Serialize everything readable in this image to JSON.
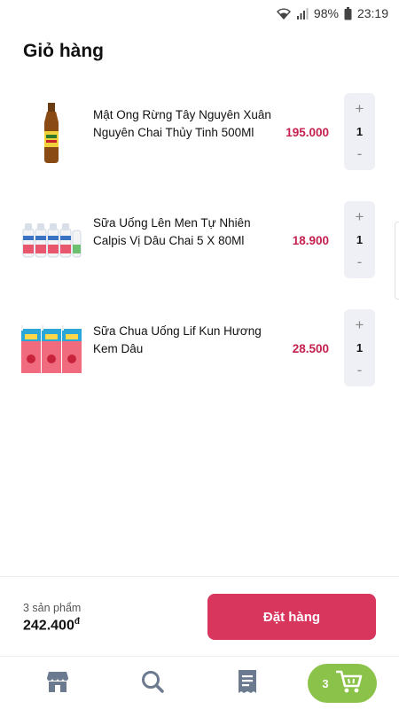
{
  "status_bar": {
    "battery": "98%",
    "time": "23:19",
    "icons": [
      "wifi-icon",
      "signal-icon",
      "battery-icon"
    ]
  },
  "page": {
    "title": "Giỏ hàng"
  },
  "cart": {
    "items": [
      {
        "name": "Mật Ong Rừng Tây Nguyên Xuân Nguyên Chai Thủy Tinh 500Ml",
        "price": "195.000",
        "qty": "1",
        "thumb": "honey-bottle-image"
      },
      {
        "name": "Sữa Uống Lên Men Tự Nhiên Calpis Vị Dâu Chai 5 X 80Ml",
        "price": "18.900",
        "qty": "1",
        "thumb": "calpis-bottles-image"
      },
      {
        "name": "Sữa Chua Uống Lif Kun Hương Kem Dâu",
        "price": "28.500",
        "qty": "1",
        "thumb": "lif-kun-boxes-image"
      }
    ],
    "plus_symbol": "+",
    "minus_symbol": "-"
  },
  "footer": {
    "product_count": "3 sản phẩm",
    "total": "242.400",
    "currency": "đ",
    "order_label": "Đặt hàng"
  },
  "bottom_nav": {
    "items": [
      "store-icon",
      "search-icon",
      "receipt-icon",
      "cart-icon"
    ],
    "cart_badge": "3"
  },
  "colors": {
    "price": "#c4214f",
    "order_button": "#d9365e",
    "cart_nav": "#8bc34a",
    "stepper_bg": "#eef0f5",
    "nav_icon": "#6b7a8f"
  }
}
